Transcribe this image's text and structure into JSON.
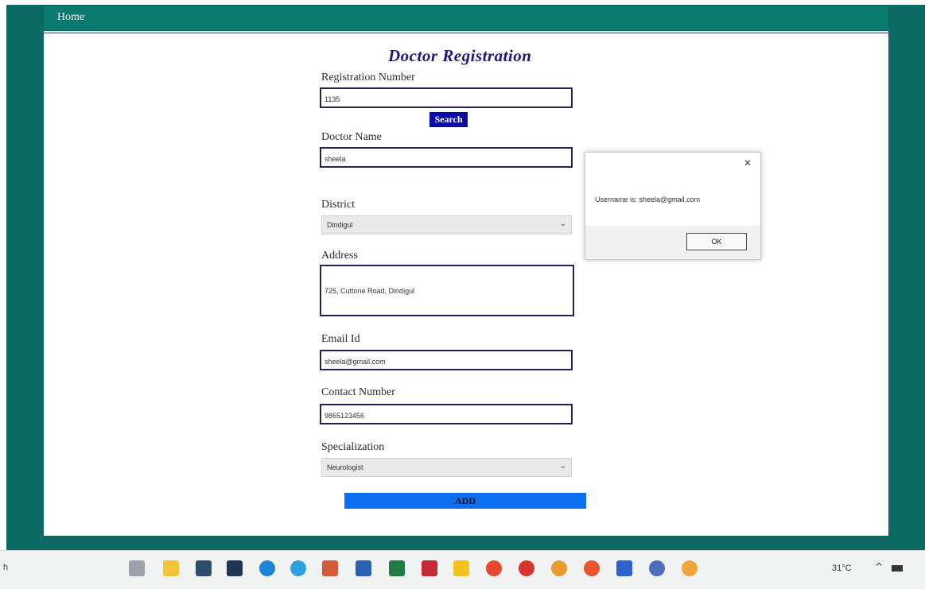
{
  "nav": {
    "home_label": "Home"
  },
  "form": {
    "title": "Doctor Registration",
    "registration_number": {
      "label": "Registration Number",
      "value": "1135"
    },
    "search_button": "Search",
    "doctor_name": {
      "label": "Doctor Name",
      "value": "sheela"
    },
    "district": {
      "label": "District",
      "selected": "Dindigul"
    },
    "address": {
      "label": "Address",
      "value": "725, Cuttone Road, Dindigul"
    },
    "email": {
      "label": "Email Id",
      "value": "sheela@gmail.com"
    },
    "contact": {
      "label": "Contact Number",
      "value": "9865123456"
    },
    "specialization": {
      "label": "Specialization",
      "selected": "Neurologist"
    },
    "add_button": "ADD"
  },
  "alert": {
    "message": "Username is: sheela@gmail.com",
    "close_glyph": "✕",
    "ok_label": "OK"
  },
  "taskbar": {
    "search_hint": "h",
    "temperature": "31°C",
    "tray_chevron": "^",
    "icons": [
      "task-view-icon",
      "file-explorer-icon",
      "store-icon",
      "dropbox-icon",
      "edge-icon",
      "telegram-icon",
      "powerpoint-icon",
      "word-icon",
      "excel-icon",
      "acrobat-icon",
      "sticky-notes-icon",
      "chrome-icon",
      "app-red-icon",
      "app-orange-icon",
      "firefox-icon",
      "app-blue-icon",
      "teams-icon",
      "weather-icon"
    ]
  },
  "colors": {
    "frame": "#0b6a63",
    "navbar": "#0a7a70",
    "title": "#1b1b7a",
    "search_button": "#0a0aa8",
    "add_button": "#0b6ff0"
  }
}
